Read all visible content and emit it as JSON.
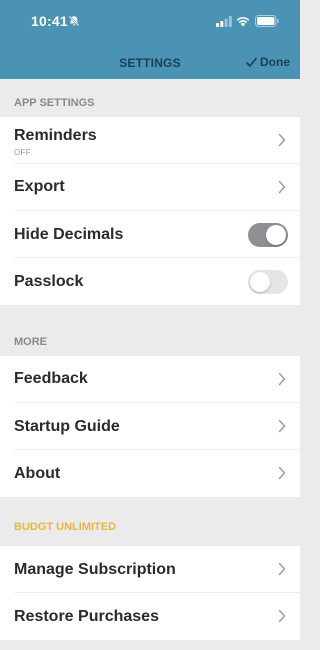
{
  "status_bar": {
    "time": "10:41"
  },
  "nav": {
    "title": "SETTINGS",
    "done_label": "Done"
  },
  "sections": {
    "app_settings": {
      "header": "APP SETTINGS",
      "reminders": {
        "label": "Reminders",
        "sublabel": "OFF"
      },
      "export": {
        "label": "Export"
      },
      "hide_decimals": {
        "label": "Hide Decimals",
        "enabled": true
      },
      "passlock": {
        "label": "Passlock",
        "enabled": false
      }
    },
    "more": {
      "header": "MORE",
      "feedback": {
        "label": "Feedback"
      },
      "startup_guide": {
        "label": "Startup Guide"
      },
      "about": {
        "label": "About"
      }
    },
    "budgt_unlimited": {
      "header": "BUDGT UNLIMITED",
      "manage_subscription": {
        "label": "Manage Subscription"
      },
      "restore_purchases": {
        "label": "Restore Purchases"
      }
    }
  },
  "colors": {
    "header_bg": "#4b93b5",
    "nav_text": "#1d3e55",
    "gold_header": "#e8b73e",
    "toggle_on": "#8e8e93"
  },
  "icons": [
    "bell-slash-icon",
    "signal-icon",
    "wifi-icon",
    "battery-icon",
    "checkmark-icon",
    "chevron-right-icon"
  ]
}
